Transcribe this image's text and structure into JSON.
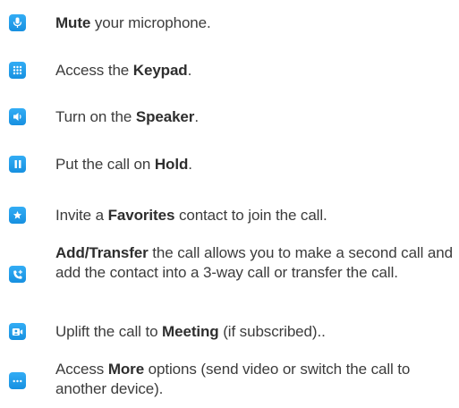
{
  "items": [
    {
      "icon": "microphone-icon",
      "pre": "",
      "bold": "Mute",
      "post": " your microphone."
    },
    {
      "icon": "keypad-icon",
      "pre": "Access the ",
      "bold": "Keypad",
      "post": "."
    },
    {
      "icon": "speaker-icon",
      "pre": "Turn on the ",
      "bold": "Speaker",
      "post": "."
    },
    {
      "icon": "pause-icon",
      "pre": "Put the call on ",
      "bold": "Hold",
      "post": "."
    },
    {
      "icon": "star-icon",
      "pre": "Invite a ",
      "bold": "Favorites",
      "post": " contact to join the call."
    },
    {
      "icon": "add-call-icon",
      "pre": "",
      "bold": "Add/Transfer",
      "post": " the call allows you to make a second call and add the contact into a 3-way call or transfer the call."
    },
    {
      "icon": "meeting-icon",
      "pre": "Uplift the call to ",
      "bold": "Meeting",
      "post": " (if subscribed).."
    },
    {
      "icon": "more-icon",
      "pre": "Access ",
      "bold": "More",
      "post": " options (send video or switch the call to another device)."
    }
  ],
  "colors": {
    "icon_bg": "#1e96e6",
    "text": "#3c3c3c"
  }
}
